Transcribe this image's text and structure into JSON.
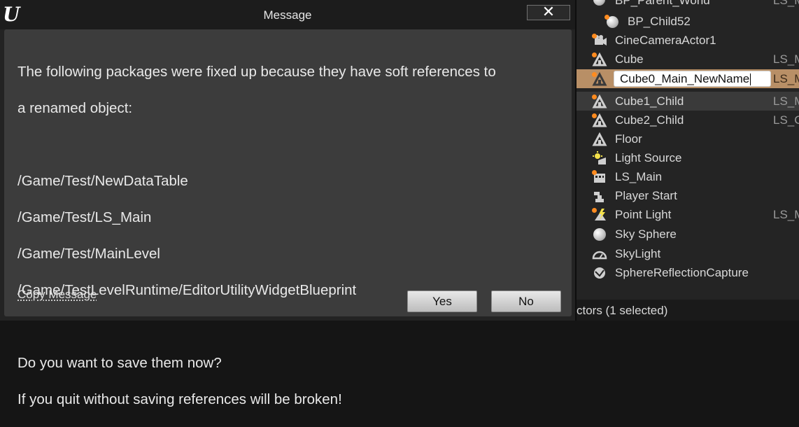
{
  "dialog": {
    "title": "Message",
    "close_glyph": "✕",
    "logo_text": "U",
    "message_lines": [
      "The following packages were fixed up because they have soft references to",
      "a renamed object:"
    ],
    "packages": [
      "/Game/Test/NewDataTable",
      "/Game/Test/LS_Main",
      "/Game/Test/MainLevel",
      "/Game/TestLevelRuntime/EditorUtilityWidgetBlueprint"
    ],
    "question_lines": [
      "Do you want to save them now?",
      "If you quit without saving references will be broken!"
    ],
    "copy_message": "Copy Message",
    "yes_label": "Yes",
    "no_label": "No"
  },
  "outliner": {
    "rows": [
      {
        "label": "BP_Parent_World",
        "level": "LS_M",
        "icon": "sphere-icon",
        "modified": false
      },
      {
        "label": "BP_Child52",
        "level": "",
        "icon": "sphere-icon",
        "modified": true
      },
      {
        "label": "CineCameraActor1",
        "level": "",
        "icon": "camera-icon",
        "modified": true
      },
      {
        "label": "Cube",
        "level": "LS_M",
        "icon": "actor-icon",
        "modified": true
      },
      {
        "label": "Cube0_Main_NewName",
        "level": "LS_M",
        "icon": "actor-icon",
        "modified": true
      },
      {
        "label": "Cube1_Child",
        "level": "LS_M",
        "icon": "actor-icon",
        "modified": true
      },
      {
        "label": "Cube2_Child",
        "level": "LS_C",
        "icon": "actor-icon",
        "modified": true
      },
      {
        "label": "Floor",
        "level": "",
        "icon": "actor-icon",
        "modified": false
      },
      {
        "label": "Light Source",
        "level": "",
        "icon": "light-icon",
        "modified": false
      },
      {
        "label": "LS_Main",
        "level": "",
        "icon": "sequence-icon",
        "modified": true
      },
      {
        "label": "Player Start",
        "level": "",
        "icon": "player-start-icon",
        "modified": false
      },
      {
        "label": "Point Light",
        "level": "LS_M",
        "icon": "point-light-icon",
        "modified": true
      },
      {
        "label": "Sky Sphere",
        "level": "",
        "icon": "sphere-icon",
        "modified": false
      },
      {
        "label": "SkyLight",
        "level": "",
        "icon": "skylight-icon",
        "modified": false
      },
      {
        "label": "SphereReflectionCapture",
        "level": "",
        "icon": "reflection-capture-icon",
        "modified": false
      }
    ],
    "rename_value": "Cube0_Main_NewName",
    "footer_text": "ctors (1 selected)"
  },
  "colors": {
    "selection": "#b88f66",
    "modified_dot": "#ff8b1f",
    "dialog_body": "#3c3c3c"
  }
}
